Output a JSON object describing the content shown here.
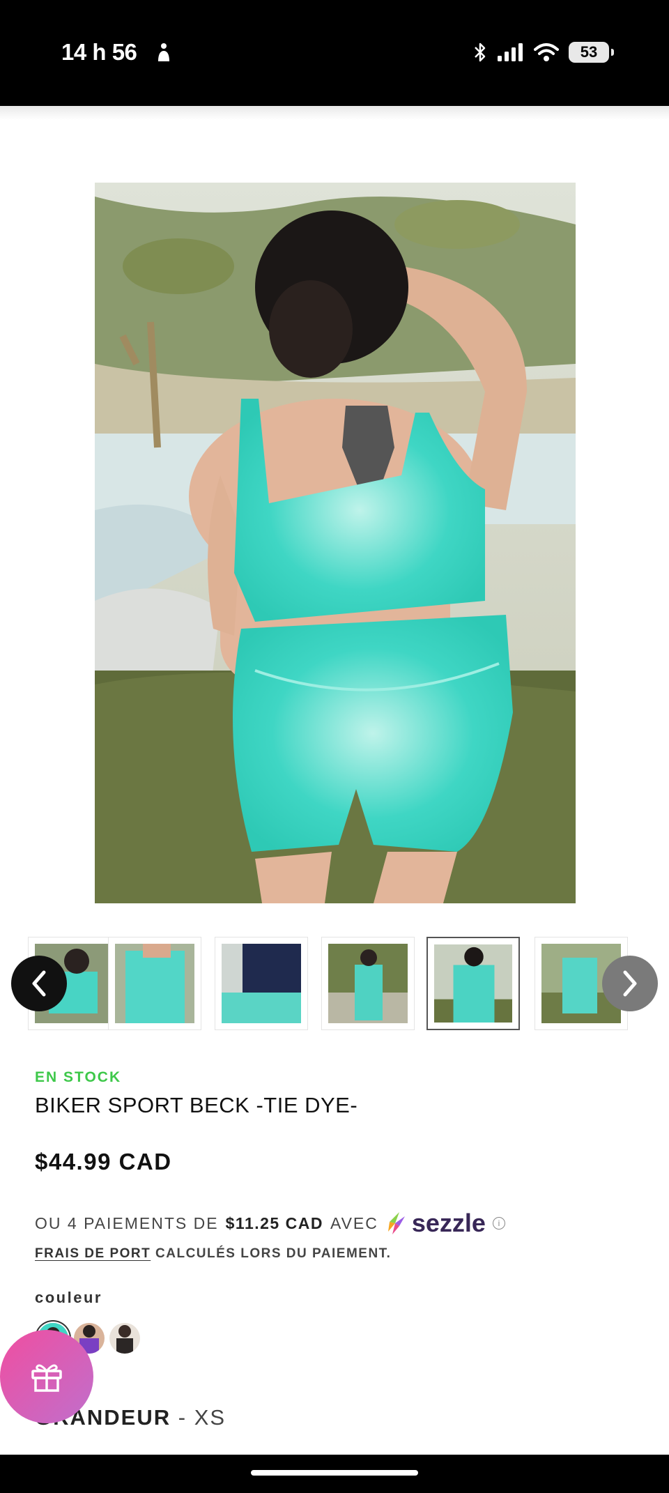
{
  "status_bar": {
    "time": "14 h 56",
    "battery": "53"
  },
  "product": {
    "stock_status": "EN STOCK",
    "title": "BIKER SPORT BECK -TIE DYE-",
    "price": "$44.99 CAD",
    "installments_prefix": "OU 4 PAIEMENTS DE",
    "installments_amount": "$11.25 CAD",
    "installments_suffix": "AVEC",
    "installments_provider": "sezzle",
    "shipping_link": "FRAIS DE PORT",
    "shipping_text": "CALCULÉS LORS DU PAIEMENT.",
    "color_label": "couleur",
    "size_label": "GRANDEUR",
    "size_separator": " - ",
    "size_value": "XS"
  },
  "gallery": {
    "thumbnail_count": 6,
    "selected_thumbnail": 5,
    "color_swatch_count": 3,
    "selected_swatch": 1
  },
  "colors": {
    "stock_green": "#3ec84a",
    "sezzle_purple": "#382757",
    "gift_pink": "#f04ea0",
    "tie_dye_teal": "#3fd6c4"
  },
  "icons": [
    "person-icon",
    "bluetooth-icon",
    "signal-icon",
    "wifi-icon",
    "battery-icon",
    "chevron-left-icon",
    "chevron-right-icon",
    "info-icon",
    "gift-icon"
  ]
}
